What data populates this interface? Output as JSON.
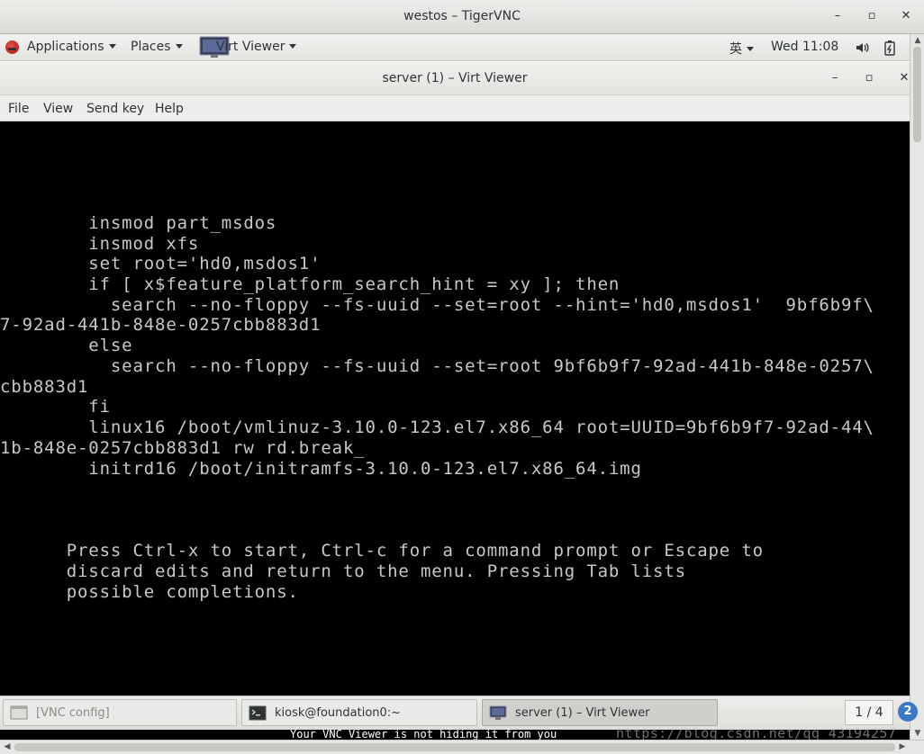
{
  "vnc_window": {
    "title": "westos – TigerVNC",
    "controls": {
      "minimize": "–",
      "maximize": "▫",
      "close": "✕"
    }
  },
  "top_panel": {
    "applications_label": "Applications",
    "places_label": "Places",
    "virt_viewer_label": "Virt Viewer",
    "input_method": "英",
    "clock": "Wed 11:08",
    "volume_icon": "speaker-icon",
    "power_icon": "battery-icon"
  },
  "viewer_window": {
    "title": "server (1) – Virt Viewer",
    "controls": {
      "minimize": "–",
      "maximize": "▫",
      "close": "✕"
    },
    "menu": {
      "file": "File",
      "view": "View",
      "send_key": "Send key",
      "help": "Help"
    }
  },
  "console": {
    "lines": [
      "        insmod part_msdos",
      "        insmod xfs",
      "        set root='hd0,msdos1'",
      "        if [ x$feature_platform_search_hint = xy ]; then",
      "          search --no-floppy --fs-uuid --set=root --hint='hd0,msdos1'  9bf6b9f\\",
      "7-92ad-441b-848e-0257cbb883d1",
      "        else",
      "          search --no-floppy --fs-uuid --set=root 9bf6b9f7-92ad-441b-848e-0257\\",
      "cbb883d1",
      "        fi",
      "        linux16 /boot/vmlinuz-3.10.0-123.el7.x86_64 root=UUID=9bf6b9f7-92ad-44\\",
      "1b-848e-0257cbb883d1 rw rd.break_",
      "        initrd16 /boot/initramfs-3.10.0-123.el7.x86_64.img"
    ],
    "help_lines": [
      "      Press Ctrl-x to start, Ctrl-c for a command prompt or Escape to",
      "      discard edits and return to the menu. Pressing Tab lists",
      "      possible completions."
    ]
  },
  "taskbar": {
    "tasks": [
      {
        "label": "[VNC config]"
      },
      {
        "label": "kiosk@foundation0:~"
      },
      {
        "label": "server (1) – Virt Viewer"
      }
    ],
    "workspace": "1 / 4",
    "help_glyph": "2"
  },
  "notice_text": "Your VNC Viewer is not hiding it from you",
  "watermark": "https://blog.csdn.net/qq_43194257"
}
